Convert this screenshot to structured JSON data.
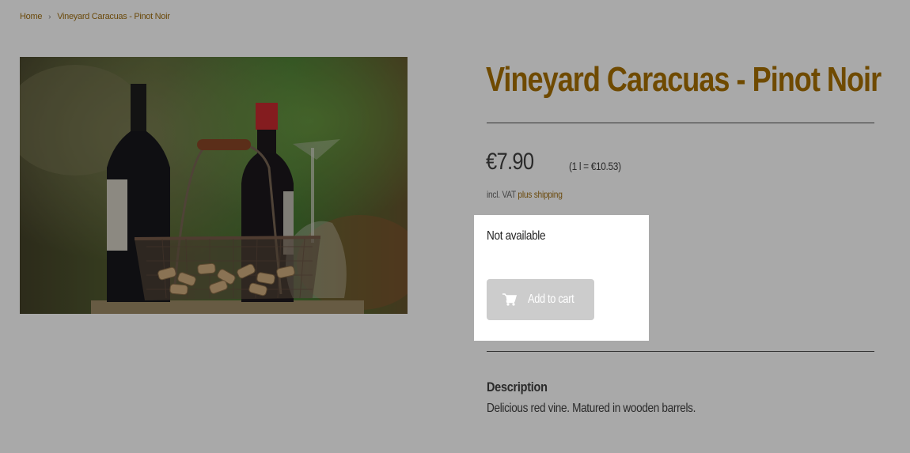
{
  "breadcrumb": {
    "home": "Home",
    "separator": "›",
    "current": "Vineyard Caracuas - Pinot Noir"
  },
  "product": {
    "title": "Vineyard Caracuas - Pinot Noir",
    "price": "€7.90",
    "unit_price": "(1 l = €10.53)",
    "vat_prefix": "incl. VAT",
    "shipping_link": "plus shipping",
    "availability": "Not available",
    "add_to_cart": "Add to cart",
    "description_heading": "Description",
    "description_text": "Delicious red vine. Matured in wooden barrels."
  },
  "colors": {
    "overlay": "#a9a9a9",
    "accent": "#6f4a00",
    "button_disabled": "#cccccc"
  },
  "icons": {
    "breadcrumb_separator": "chevron-right-icon",
    "cart": "shopping-cart-icon"
  }
}
